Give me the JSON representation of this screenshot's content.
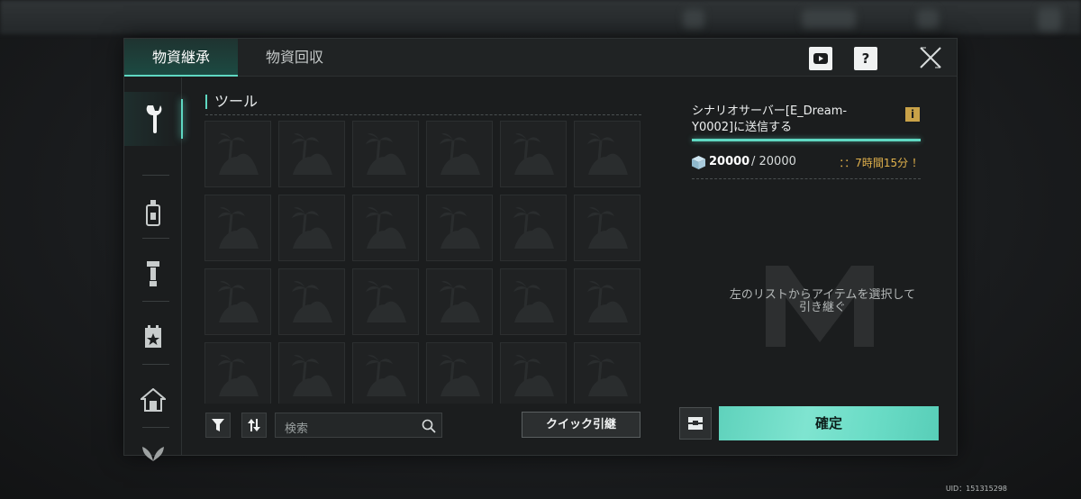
{
  "tabs": [
    {
      "label": "物資継承",
      "active": true
    },
    {
      "label": "物資回収",
      "active": false
    }
  ],
  "topbar": {
    "video_icon": "youtube-icon",
    "help_label": "?",
    "close_icon": "close-icon"
  },
  "sidebar": {
    "items": [
      {
        "icon": "wrench-icon",
        "active": true
      },
      {
        "icon": "bottle-icon",
        "active": false
      },
      {
        "icon": "tool-stand-icon",
        "active": false
      },
      {
        "icon": "calendar-star-icon",
        "active": false
      },
      {
        "icon": "house-icon",
        "active": false
      },
      {
        "icon": "wings-icon",
        "active": false
      }
    ]
  },
  "section": {
    "title": "ツール",
    "slot_icon": "palm-island-placeholder-icon"
  },
  "bottom": {
    "filter_icon": "filter-icon",
    "sort_icon": "sort-icon",
    "search_placeholder": "検索",
    "search_icon": "search-icon",
    "quick_button": "クイック引継"
  },
  "right": {
    "target_text": "シナリオサーバー[E_Dream-Y0002]に送信する",
    "info_label": "i",
    "capacity_current": "20000",
    "capacity_max": "/ 20000",
    "timer": "：：7時間15分 ！",
    "empty_message_line1": "左のリストからアイテムを選択して",
    "empty_message_line2": "引き継ぐ",
    "mail_icon": "mailbox-icon",
    "confirm_label": "確定"
  },
  "uid_text": "UID：151315298",
  "colors": {
    "accent": "#5fd8c2",
    "warning": "#e2b24c",
    "panel": "#1b1d1e"
  }
}
